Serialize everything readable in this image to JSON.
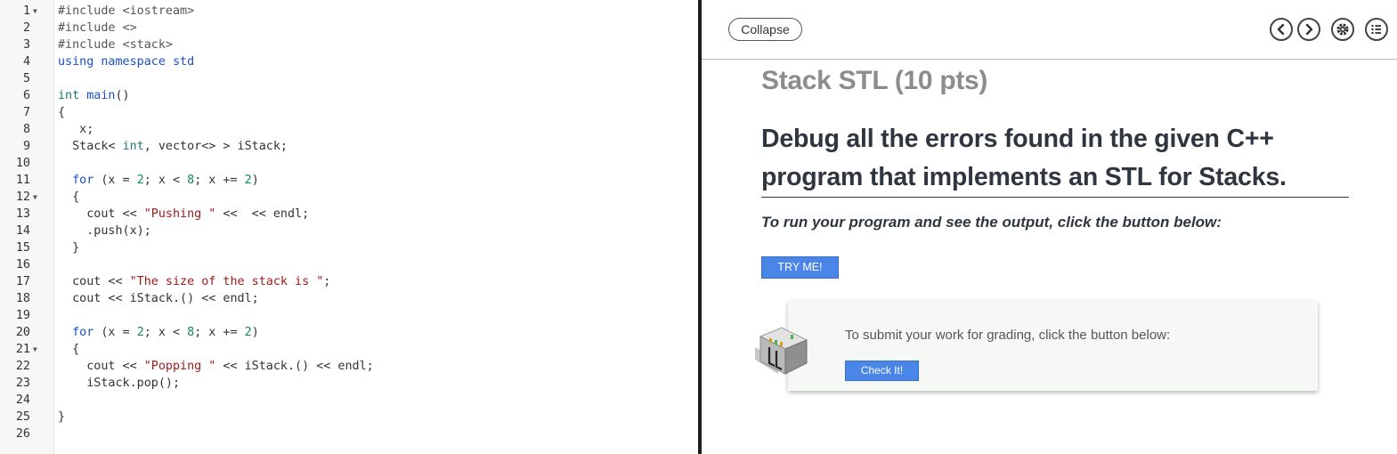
{
  "editor": {
    "lines": [
      {
        "num": "1",
        "fold": "true",
        "tokens": [
          {
            "t": "#include <iostream>",
            "c": "pre"
          }
        ]
      },
      {
        "num": "2",
        "fold": "false",
        "tokens": [
          {
            "t": "#include <>",
            "c": "pre"
          }
        ]
      },
      {
        "num": "3",
        "fold": "false",
        "tokens": [
          {
            "t": "#include <stack>",
            "c": "pre"
          }
        ]
      },
      {
        "num": "4",
        "fold": "false",
        "tokens": [
          {
            "t": "using namespace std",
            "c": "kw"
          }
        ]
      },
      {
        "num": "5",
        "fold": "false",
        "tokens": []
      },
      {
        "num": "6",
        "fold": "false",
        "tokens": [
          {
            "t": "int",
            "c": "type"
          },
          {
            "t": " ",
            "c": ""
          },
          {
            "t": "main",
            "c": "fn"
          },
          {
            "t": "()",
            "c": ""
          }
        ]
      },
      {
        "num": "7",
        "fold": "false",
        "tokens": [
          {
            "t": "{",
            "c": ""
          }
        ]
      },
      {
        "num": "8",
        "fold": "false",
        "tokens": [
          {
            "t": "   x;",
            "c": ""
          }
        ]
      },
      {
        "num": "9",
        "fold": "false",
        "tokens": [
          {
            "t": "  Stack< ",
            "c": ""
          },
          {
            "t": "int",
            "c": "type"
          },
          {
            "t": ", vector<> > iStack;",
            "c": ""
          }
        ]
      },
      {
        "num": "10",
        "fold": "false",
        "tokens": []
      },
      {
        "num": "11",
        "fold": "false",
        "tokens": [
          {
            "t": "  ",
            "c": ""
          },
          {
            "t": "for",
            "c": "kw"
          },
          {
            "t": " (x = ",
            "c": ""
          },
          {
            "t": "2",
            "c": "num"
          },
          {
            "t": "; x < ",
            "c": ""
          },
          {
            "t": "8",
            "c": "num"
          },
          {
            "t": "; x += ",
            "c": ""
          },
          {
            "t": "2",
            "c": "num"
          },
          {
            "t": ")",
            "c": ""
          }
        ]
      },
      {
        "num": "12",
        "fold": "true",
        "tokens": [
          {
            "t": "  {",
            "c": ""
          }
        ]
      },
      {
        "num": "13",
        "fold": "false",
        "tokens": [
          {
            "t": "    cout << ",
            "c": ""
          },
          {
            "t": "\"Pushing \"",
            "c": "str"
          },
          {
            "t": " <<  << endl;",
            "c": ""
          }
        ]
      },
      {
        "num": "14",
        "fold": "false",
        "tokens": [
          {
            "t": "    .push(x);",
            "c": ""
          }
        ]
      },
      {
        "num": "15",
        "fold": "false",
        "tokens": [
          {
            "t": "  }",
            "c": ""
          }
        ]
      },
      {
        "num": "16",
        "fold": "false",
        "tokens": []
      },
      {
        "num": "17",
        "fold": "false",
        "tokens": [
          {
            "t": "  cout << ",
            "c": ""
          },
          {
            "t": "\"The size of the stack is \"",
            "c": "str"
          },
          {
            "t": ";",
            "c": ""
          }
        ]
      },
      {
        "num": "18",
        "fold": "false",
        "tokens": [
          {
            "t": "  cout << iStack.() << endl;",
            "c": ""
          }
        ]
      },
      {
        "num": "19",
        "fold": "false",
        "tokens": []
      },
      {
        "num": "20",
        "fold": "false",
        "tokens": [
          {
            "t": "  ",
            "c": ""
          },
          {
            "t": "for",
            "c": "kw"
          },
          {
            "t": " (x = ",
            "c": ""
          },
          {
            "t": "2",
            "c": "num"
          },
          {
            "t": "; x < ",
            "c": ""
          },
          {
            "t": "8",
            "c": "num"
          },
          {
            "t": "; x += ",
            "c": ""
          },
          {
            "t": "2",
            "c": "num"
          },
          {
            "t": ")",
            "c": ""
          }
        ]
      },
      {
        "num": "21",
        "fold": "true",
        "tokens": [
          {
            "t": "  {",
            "c": ""
          }
        ]
      },
      {
        "num": "22",
        "fold": "false",
        "tokens": [
          {
            "t": "    cout << ",
            "c": ""
          },
          {
            "t": "\"Popping \"",
            "c": "str"
          },
          {
            "t": " << iStack.() << endl;",
            "c": ""
          }
        ]
      },
      {
        "num": "23",
        "fold": "false",
        "tokens": [
          {
            "t": "    iStack.pop();",
            "c": ""
          }
        ]
      },
      {
        "num": "24",
        "fold": "false",
        "tokens": []
      },
      {
        "num": "25",
        "fold": "false",
        "tokens": [
          {
            "t": "}",
            "c": ""
          }
        ]
      },
      {
        "num": "26",
        "fold": "false",
        "tokens": []
      }
    ]
  },
  "panel": {
    "collapse_label": "Collapse",
    "nav_icons": [
      "chevron-left-icon",
      "chevron-right-icon",
      "gear-icon",
      "list-icon"
    ],
    "section_title": "Stack STL (10 pts)",
    "headline": "Debug all the errors found in the given C++ program that implements an STL for Stacks.",
    "run_instruction": "To run your program and see the output, click the button below:",
    "try_button_label": "TRY ME!",
    "submit_instruction": "To submit your work for grading, click the button below:",
    "check_button_label": "Check It!"
  },
  "colors": {
    "button_blue": "#4a86e8",
    "keyword": "#1a4fc9",
    "type": "#1d7a73",
    "number": "#0e8a5b",
    "string": "#a11a1a",
    "title_gray": "#8c8c8c"
  }
}
